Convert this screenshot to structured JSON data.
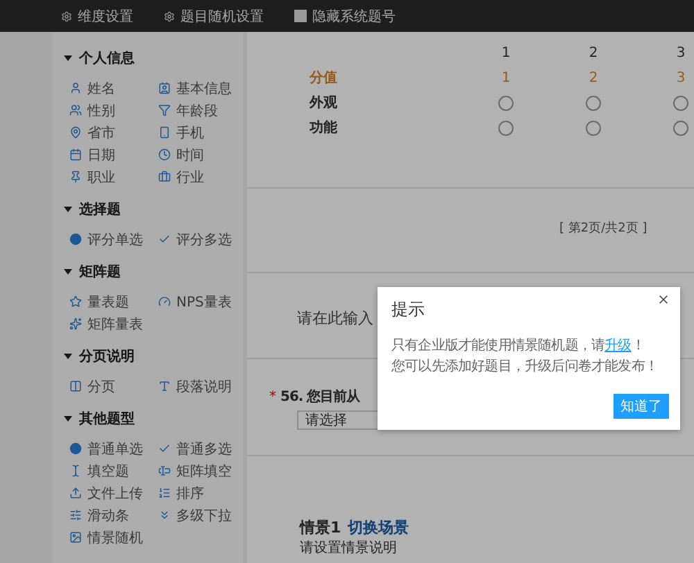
{
  "top_bar": {
    "items": [
      {
        "label": "维度设置",
        "kind": "gear"
      },
      {
        "label": "题目随机设置",
        "kind": "gear"
      },
      {
        "label": "隐藏系统题号",
        "kind": "checkbox",
        "checked": false
      }
    ]
  },
  "sidebar": {
    "sections": [
      {
        "title": "个人信息",
        "expanded": true,
        "items": [
          "姓名",
          "基本信息",
          "性别",
          "年龄段",
          "省市",
          "手机",
          "日期",
          "时间",
          "职业",
          "行业"
        ]
      },
      {
        "title": "选择题",
        "expanded": true,
        "items": [
          "评分单选",
          "评分多选"
        ]
      },
      {
        "title": "矩阵题",
        "expanded": true,
        "items": [
          "量表题",
          "NPS量表",
          "矩阵量表"
        ]
      },
      {
        "title": "分页说明",
        "expanded": true,
        "items": [
          "分页",
          "段落说明"
        ]
      },
      {
        "title": "其他题型",
        "expanded": true,
        "items": [
          "普通单选",
          "普通多选",
          "填空题",
          "矩阵填空",
          "文件上传",
          "排序",
          "滑动条",
          "多级下拉",
          "情景随机"
        ]
      }
    ]
  },
  "matrix_question": {
    "columns": [
      "1",
      "2",
      "3"
    ],
    "score_row": {
      "label": "分值",
      "values": [
        "1",
        "2",
        "3"
      ]
    },
    "rows": [
      {
        "label": "外观",
        "cells": [
          {
            "selected": false
          },
          {
            "selected": false
          },
          {
            "selected": false
          }
        ]
      },
      {
        "label": "功能",
        "cells": [
          {
            "selected": false
          },
          {
            "selected": false
          },
          {
            "selected": false
          }
        ]
      }
    ]
  },
  "pagination": "[ 第2页/共2页 ]",
  "description": "请在此输入",
  "question_56": {
    "title": "56. 您目前从",
    "required_mark": "*",
    "select": {
      "placeholder": "请选择"
    }
  },
  "scenario": {
    "title": "情景1",
    "link": "切换场景",
    "hint": "请设置情景说明"
  },
  "dialog": {
    "title": "提示",
    "lines": [
      {
        "before": "只有企业版才能使用情景随机题，请",
        "link": "升级",
        "after": "！"
      },
      {
        "before": "您可以先添加好题目，升级后问卷才能发布！"
      }
    ],
    "button": "知道了"
  }
}
